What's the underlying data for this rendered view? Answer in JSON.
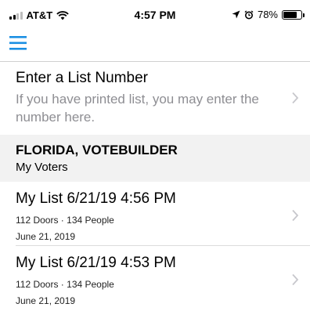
{
  "status_bar": {
    "carrier": "AT&T",
    "time": "4:57 PM",
    "battery": "78%",
    "battery_level": 0.78,
    "icons": [
      "cell-signal-icon",
      "wifi-icon",
      "location-arrow-icon",
      "alarm-icon",
      "battery-icon"
    ]
  },
  "nav": {
    "menu_icon": "hamburger-menu-icon",
    "accent_color": "#1a8fe3"
  },
  "enter_list": {
    "title": "Enter a List Number",
    "subtitle": "If you have printed list, you may enter the number here."
  },
  "section": {
    "title": "FLORIDA, VOTEBUILDER",
    "subtitle": "My Voters"
  },
  "lists": [
    {
      "title": "My List 6/21/19 4:56 PM",
      "counts": "112 Doors · 134 People",
      "date": "June 21, 2019"
    },
    {
      "title": "My List 6/21/19 4:53 PM",
      "counts": "112 Doors · 134 People",
      "date": "June 21, 2019"
    }
  ]
}
